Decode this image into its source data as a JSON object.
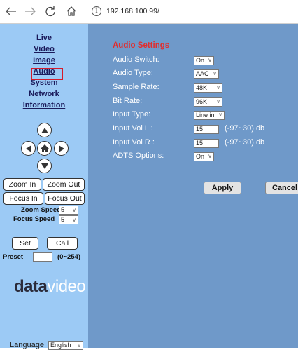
{
  "browser": {
    "url": "192.168.100.99/",
    "info_glyph": "i"
  },
  "sidebar": {
    "menu": [
      "Live",
      "Video",
      "Image",
      "Audio",
      "System",
      "Network",
      "Information"
    ],
    "active": "Audio",
    "zoom_in": "Zoom In",
    "zoom_out": "Zoom Out",
    "focus_in": "Focus In",
    "focus_out": "Focus Out",
    "zoom_speed_label": "Zoom Speed",
    "zoom_speed_value": "5",
    "focus_speed_label": "Focus Speed",
    "focus_speed_value": "5",
    "set": "Set",
    "call": "Call",
    "preset_label": "Preset",
    "preset_range": "(0~254)",
    "logo_part1": "data",
    "logo_part2": "video",
    "language_label": "Language",
    "language_value": "English"
  },
  "audio": {
    "title": "Audio Settings",
    "rows": [
      {
        "label": "Audio Switch:",
        "value": "On"
      },
      {
        "label": "Audio Type:",
        "value": "AAC"
      },
      {
        "label": "Sample Rate:",
        "value": "48K"
      },
      {
        "label": "Bit Rate:",
        "value": "96K"
      },
      {
        "label": "Input Type:",
        "value": "Line in"
      },
      {
        "label": "Input Vol L :",
        "value": "15",
        "range": "(-97~30) db"
      },
      {
        "label": "Input Vol R :",
        "value": "15",
        "range": "(-97~30) db"
      },
      {
        "label": "ADTS Options:",
        "value": "On"
      }
    ],
    "apply": "Apply",
    "cancel": "Cancel"
  },
  "colors": {
    "sidebar_bg": "#9ccaf5",
    "main_bg": "#6f99c9",
    "title_red": "#e12d2d",
    "highlight_box": "#d51b2b"
  }
}
